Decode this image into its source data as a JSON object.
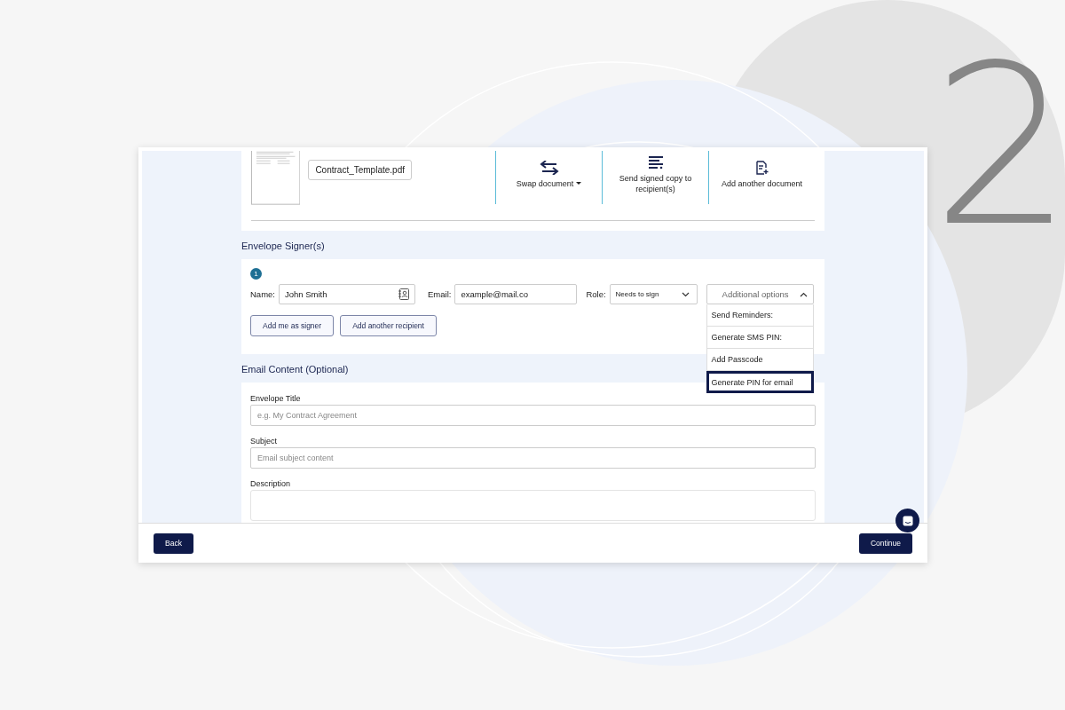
{
  "step_number": "2",
  "document": {
    "file_name": "Contract_Template.pdf",
    "actions": [
      {
        "label": "Swap document",
        "kind": "swap"
      },
      {
        "label": "Send signed copy to recipient(s)",
        "kind": "send"
      },
      {
        "label": "Add another document",
        "kind": "add"
      }
    ]
  },
  "signers_heading": "Envelope Signer(s)",
  "signer": {
    "number": "1",
    "name_label": "Name:",
    "name_value": "John Smith",
    "email_label": "Email:",
    "email_value": "example@mail.co",
    "role_label": "Role:",
    "role_value": "Needs to sign",
    "options": {
      "label": "Additional options",
      "expanded": true,
      "items": [
        {
          "label": "Send Reminders:",
          "selected": false
        },
        {
          "label": "Generate SMS PIN:",
          "selected": false
        },
        {
          "label": "Add Passcode",
          "selected": false
        },
        {
          "label": "Generate PIN for email",
          "selected": true
        }
      ]
    }
  },
  "signer_buttons": [
    "Add me as signer",
    "Add another recipient"
  ],
  "email_heading": "Email Content (Optional)",
  "email_fields": [
    {
      "label": "Envelope Title",
      "placeholder": "e.g. My Contract Agreement",
      "kind": "input"
    },
    {
      "label": "Subject",
      "placeholder": "Email subject content",
      "kind": "input"
    },
    {
      "label": "Description",
      "kind": "textarea"
    }
  ],
  "footer": {
    "back": "Back",
    "continue": "Continue"
  }
}
